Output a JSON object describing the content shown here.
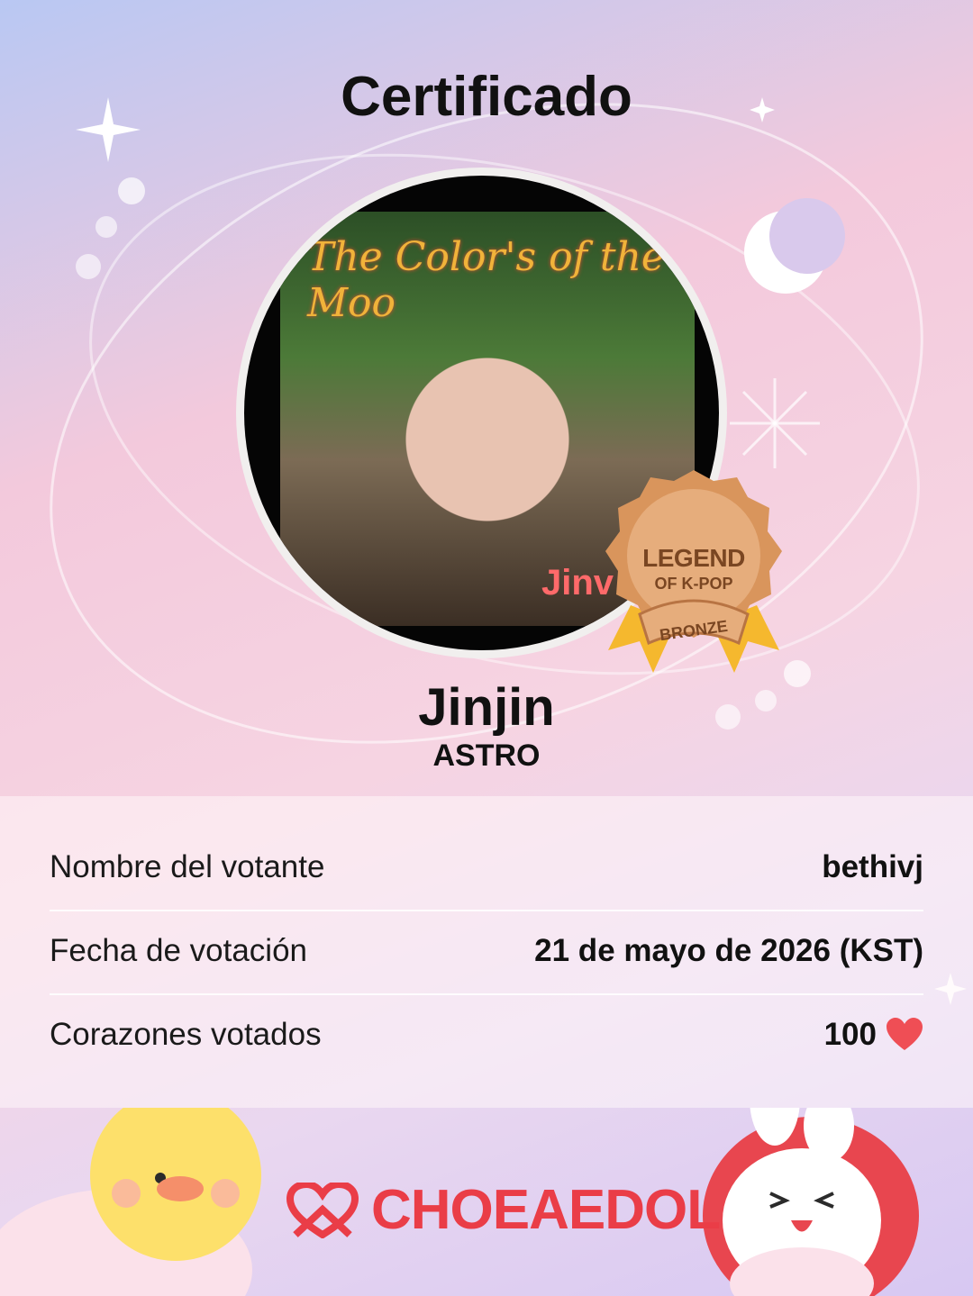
{
  "certificate": {
    "title": "Certificado"
  },
  "idol": {
    "name": "Jinjin",
    "group": "ASTRO",
    "photo_caption": "The Color's of the Moo",
    "photo_name_tag": "Jinv"
  },
  "badge": {
    "line1": "LEGEND",
    "line2": "OF K-POP",
    "tier": "BRONZE"
  },
  "details": [
    {
      "label": "Nombre del votante",
      "value": "bethivj"
    },
    {
      "label": "Fecha de votación",
      "value": "21 de mayo de 2026 (KST)"
    },
    {
      "label": "Corazones votados",
      "value": "100"
    }
  ],
  "brand": {
    "name": "CHOEAEDOL",
    "color": "#ea3d47"
  },
  "icons": [
    "heart-icon",
    "choeaedol-logo-icon",
    "moon-icon",
    "sparkle-icon",
    "chick-mascot",
    "bunny-mascot"
  ]
}
